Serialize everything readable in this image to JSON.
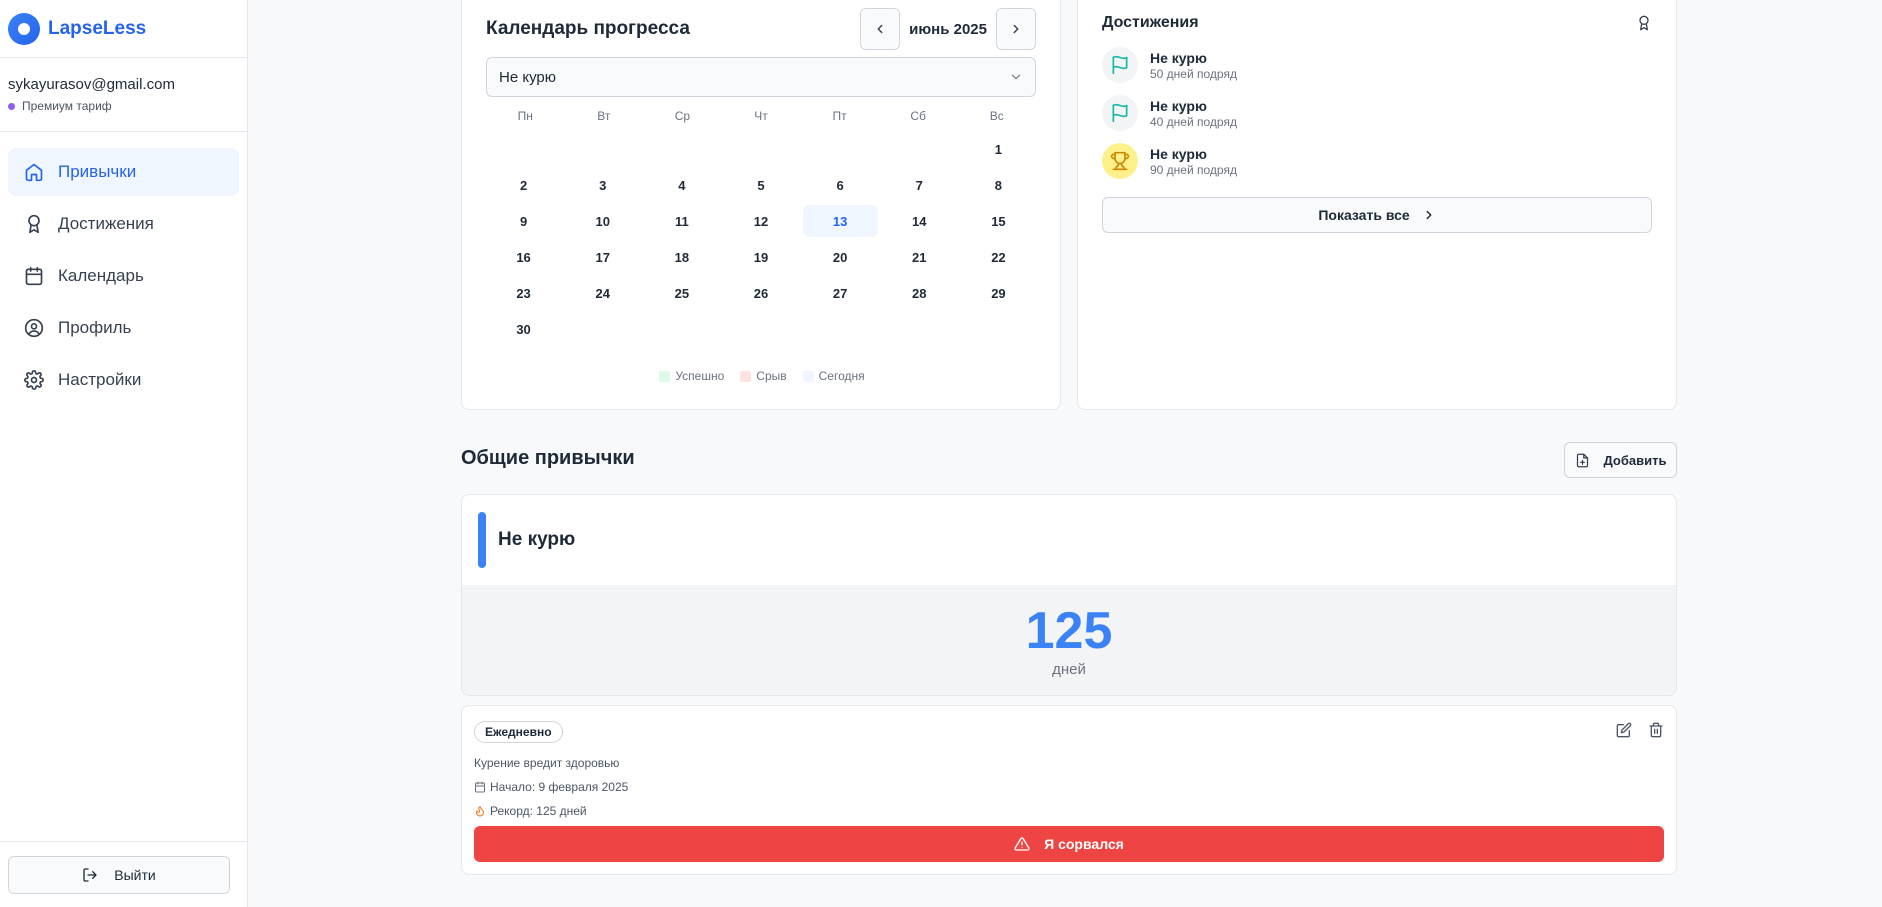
{
  "app": {
    "name": "LapseLess"
  },
  "user": {
    "email": "sykayurasov@gmail.com",
    "plan": "Премиум тариф"
  },
  "nav": [
    {
      "label": "Привычки",
      "icon": "home-icon",
      "active": true
    },
    {
      "label": "Достижения",
      "icon": "award-icon",
      "active": false
    },
    {
      "label": "Календарь",
      "icon": "calendar-icon",
      "active": false
    },
    {
      "label": "Профиль",
      "icon": "user-circle-icon",
      "active": false
    },
    {
      "label": "Настройки",
      "icon": "gear-icon",
      "active": false
    }
  ],
  "logout": {
    "label": "Выйти"
  },
  "calendar": {
    "title": "Календарь прогресса",
    "month": "июнь 2025",
    "selected_habit": "Не курю",
    "weekdays": [
      "Пн",
      "Вт",
      "Ср",
      "Чт",
      "Пт",
      "Сб",
      "Вс"
    ],
    "leading_blanks": 6,
    "days_in_month": 30,
    "today": 13,
    "legend": [
      {
        "label": "Успешно",
        "color": "#dcfce7"
      },
      {
        "label": "Срыв",
        "color": "#fee2e2"
      },
      {
        "label": "Сегодня",
        "color": "#eff6ff"
      }
    ]
  },
  "achievements": {
    "title": "Достижения",
    "items": [
      {
        "name": "Не курю",
        "sub": "50 дней подряд",
        "icon": "flag-icon",
        "bg": "#f3f4f6",
        "fg": "#14b8a6"
      },
      {
        "name": "Не курю",
        "sub": "40 дней подряд",
        "icon": "flag-icon",
        "bg": "#f3f4f6",
        "fg": "#14b8a6"
      },
      {
        "name": "Не курю",
        "sub": "90 дней подряд",
        "icon": "trophy-icon",
        "bg": "#fef08a",
        "fg": "#ca8a04"
      }
    ],
    "show_all": "Показать все"
  },
  "habits_section": {
    "title": "Общие привычки",
    "add_label": "Добавить"
  },
  "habit": {
    "name": "Не курю",
    "accent_color": "#3b82f6",
    "count": "125",
    "unit": "дней",
    "frequency": "Ежедневно",
    "description": "Курение вредит здоровью",
    "start": "Начало: 9 февраля 2025",
    "record": "Рекорд: 125 дней",
    "relapse_label": "Я сорвался"
  }
}
